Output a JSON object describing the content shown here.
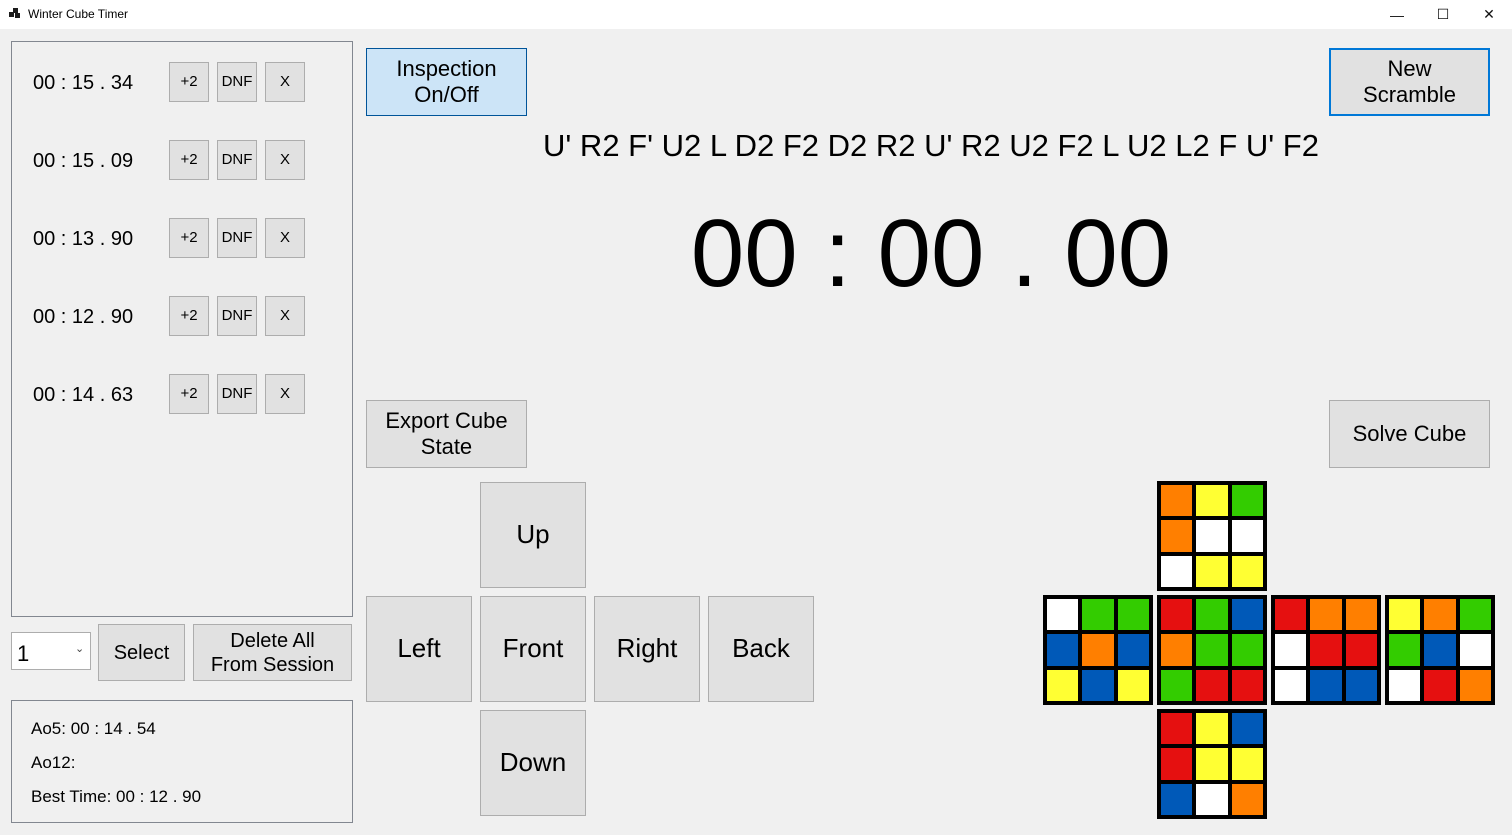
{
  "window": {
    "title": "Winter Cube Timer",
    "controls": [
      "—",
      "☐",
      "✕"
    ]
  },
  "times": [
    {
      "time": "00 : 15 . 34",
      "plus2": "+2",
      "dnf": "DNF",
      "delete": "X"
    },
    {
      "time": "00 : 15 . 09",
      "plus2": "+2",
      "dnf": "DNF",
      "delete": "X"
    },
    {
      "time": "00 : 13 . 90",
      "plus2": "+2",
      "dnf": "DNF",
      "delete": "X"
    },
    {
      "time": "00 : 12 . 90",
      "plus2": "+2",
      "dnf": "DNF",
      "delete": "X"
    },
    {
      "time": "00 : 14 . 63",
      "plus2": "+2",
      "dnf": "DNF",
      "delete": "X"
    }
  ],
  "session": {
    "selected": "1",
    "select_label": "Select",
    "delete_all_label": "Delete All\nFrom Session"
  },
  "stats": {
    "ao5": "Ao5: 00 : 14 . 54",
    "ao12": "Ao12:",
    "best": "Best Time: 00 : 12 . 90"
  },
  "controls": {
    "inspection_label": "Inspection\nOn/Off",
    "new_scramble_label": "New\nScramble",
    "export_label": "Export Cube\nState",
    "solve_label": "Solve Cube"
  },
  "scramble": "U' R2 F' U2 L D2 F2 D2 R2 U' R2 U2 F2 L U2 L2 F U' F2",
  "timer": "00 : 00 . 00",
  "directions": {
    "up": "Up",
    "left": "Left",
    "front": "Front",
    "right": "Right",
    "back": "Back",
    "down": "Down"
  },
  "colors": {
    "O": "#ff7f00",
    "Y": "#ffff33",
    "G": "#33cc00",
    "W": "#ffffff",
    "R": "#e51010",
    "B": "#0059b8"
  },
  "cube": {
    "up": [
      "O",
      "Y",
      "G",
      "O",
      "W",
      "W",
      "W",
      "Y",
      "Y"
    ],
    "left": [
      "W",
      "G",
      "G",
      "B",
      "O",
      "B",
      "Y",
      "B",
      "Y"
    ],
    "front": [
      "R",
      "G",
      "B",
      "O",
      "G",
      "G",
      "G",
      "R",
      "R"
    ],
    "right": [
      "R",
      "O",
      "O",
      "W",
      "R",
      "R",
      "W",
      "B",
      "B"
    ],
    "back": [
      "Y",
      "O",
      "G",
      "G",
      "B",
      "W",
      "W",
      "R",
      "O"
    ],
    "down": [
      "R",
      "Y",
      "B",
      "R",
      "Y",
      "Y",
      "B",
      "W",
      "O"
    ]
  }
}
